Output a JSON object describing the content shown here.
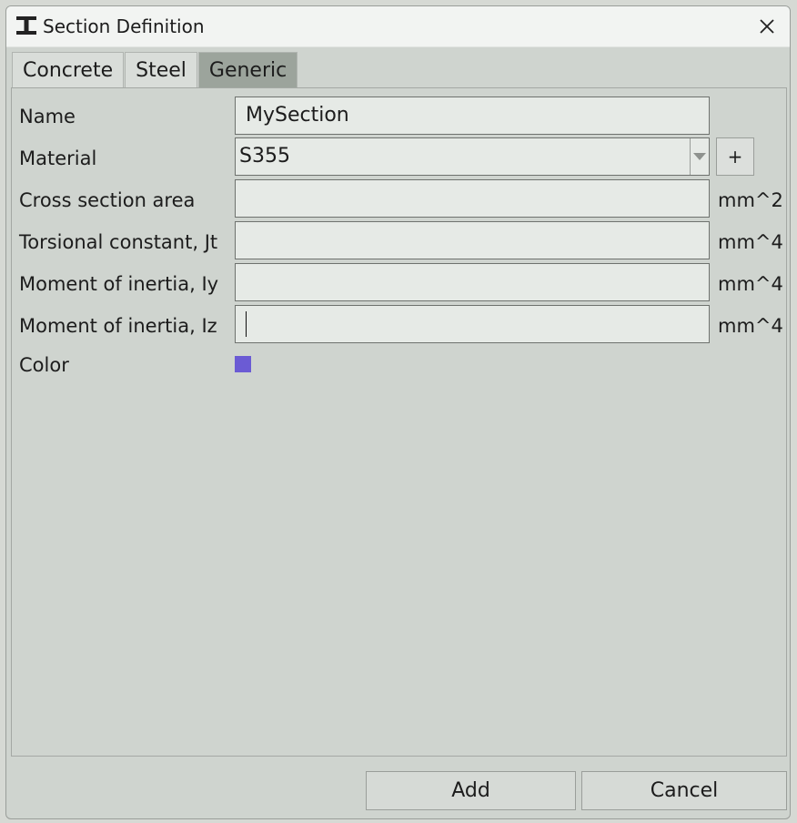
{
  "window": {
    "title": "Section Definition",
    "app_icon": "i-beam-icon",
    "close_icon": "close-icon"
  },
  "tabs": [
    {
      "label": "Concrete",
      "active": false
    },
    {
      "label": "Steel",
      "active": false
    },
    {
      "label": "Generic",
      "active": true
    }
  ],
  "form": {
    "name": {
      "label": "Name",
      "value": "MySection"
    },
    "material": {
      "label": "Material",
      "value": "S355",
      "add_label": "+"
    },
    "area": {
      "label": "Cross section area",
      "value": "",
      "unit": "mm^2"
    },
    "jt": {
      "label": "Torsional constant, Jt",
      "value": "",
      "unit": "mm^4"
    },
    "iy": {
      "label": "Moment of inertia, Iy",
      "value": "",
      "unit": "mm^4"
    },
    "iz": {
      "label": "Moment of inertia, Iz",
      "value": "",
      "unit": "mm^4"
    },
    "color": {
      "label": "Color",
      "value": "#6b5bd4"
    }
  },
  "buttons": {
    "add": "Add",
    "cancel": "Cancel"
  }
}
